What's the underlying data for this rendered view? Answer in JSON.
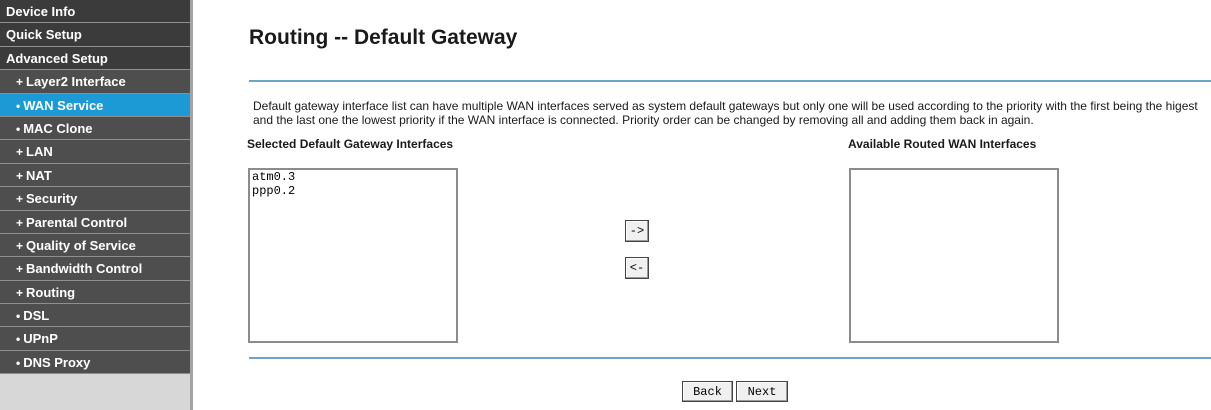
{
  "sidebar": {
    "items": [
      {
        "label": "Device Info",
        "level": "top",
        "active": false
      },
      {
        "label": "Quick Setup",
        "level": "top",
        "active": false
      },
      {
        "label": "Advanced Setup",
        "level": "top",
        "active": false
      },
      {
        "label": "Layer2 Interface",
        "level": "sub",
        "bullet": "+",
        "active": false
      },
      {
        "label": "WAN Service",
        "level": "sub",
        "bullet": "•",
        "active": true
      },
      {
        "label": "MAC Clone",
        "level": "sub",
        "bullet": "•",
        "active": false
      },
      {
        "label": "LAN",
        "level": "sub",
        "bullet": "+",
        "active": false
      },
      {
        "label": "NAT",
        "level": "sub",
        "bullet": "+",
        "active": false
      },
      {
        "label": "Security",
        "level": "sub",
        "bullet": "+",
        "active": false
      },
      {
        "label": "Parental Control",
        "level": "sub",
        "bullet": "+",
        "active": false
      },
      {
        "label": "Quality of Service",
        "level": "sub",
        "bullet": "+",
        "active": false
      },
      {
        "label": "Bandwidth Control",
        "level": "sub",
        "bullet": "+",
        "active": false
      },
      {
        "label": "Routing",
        "level": "sub",
        "bullet": "+",
        "active": false
      },
      {
        "label": "DSL",
        "level": "sub",
        "bullet": "•",
        "active": false
      },
      {
        "label": "UPnP",
        "level": "sub",
        "bullet": "•",
        "active": false
      },
      {
        "label": "DNS Proxy",
        "level": "sub",
        "bullet": "•",
        "active": false
      }
    ]
  },
  "main": {
    "title": "Routing -- Default Gateway",
    "description": "Default gateway interface list can have multiple WAN interfaces served as system default gateways but only one will be used according to the priority with the first being the higest and the last one the lowest priority if the WAN interface is connected. Priority order can be changed by removing all and adding them back in again.",
    "selected_label": "Selected Default Gateway Interfaces",
    "available_label": "Available Routed WAN Interfaces",
    "selected_items": [
      "atm0.3",
      "ppp0.2"
    ],
    "available_items": [],
    "move_right_label": "->",
    "move_left_label": "<-",
    "back_label": "Back",
    "next_label": "Next"
  },
  "colors": {
    "sidebar_top": "#3b3b3b",
    "sidebar_sub": "#4e4e4e",
    "sidebar_active": "#1b9ad6",
    "divider_line": "#6fa4c2"
  }
}
